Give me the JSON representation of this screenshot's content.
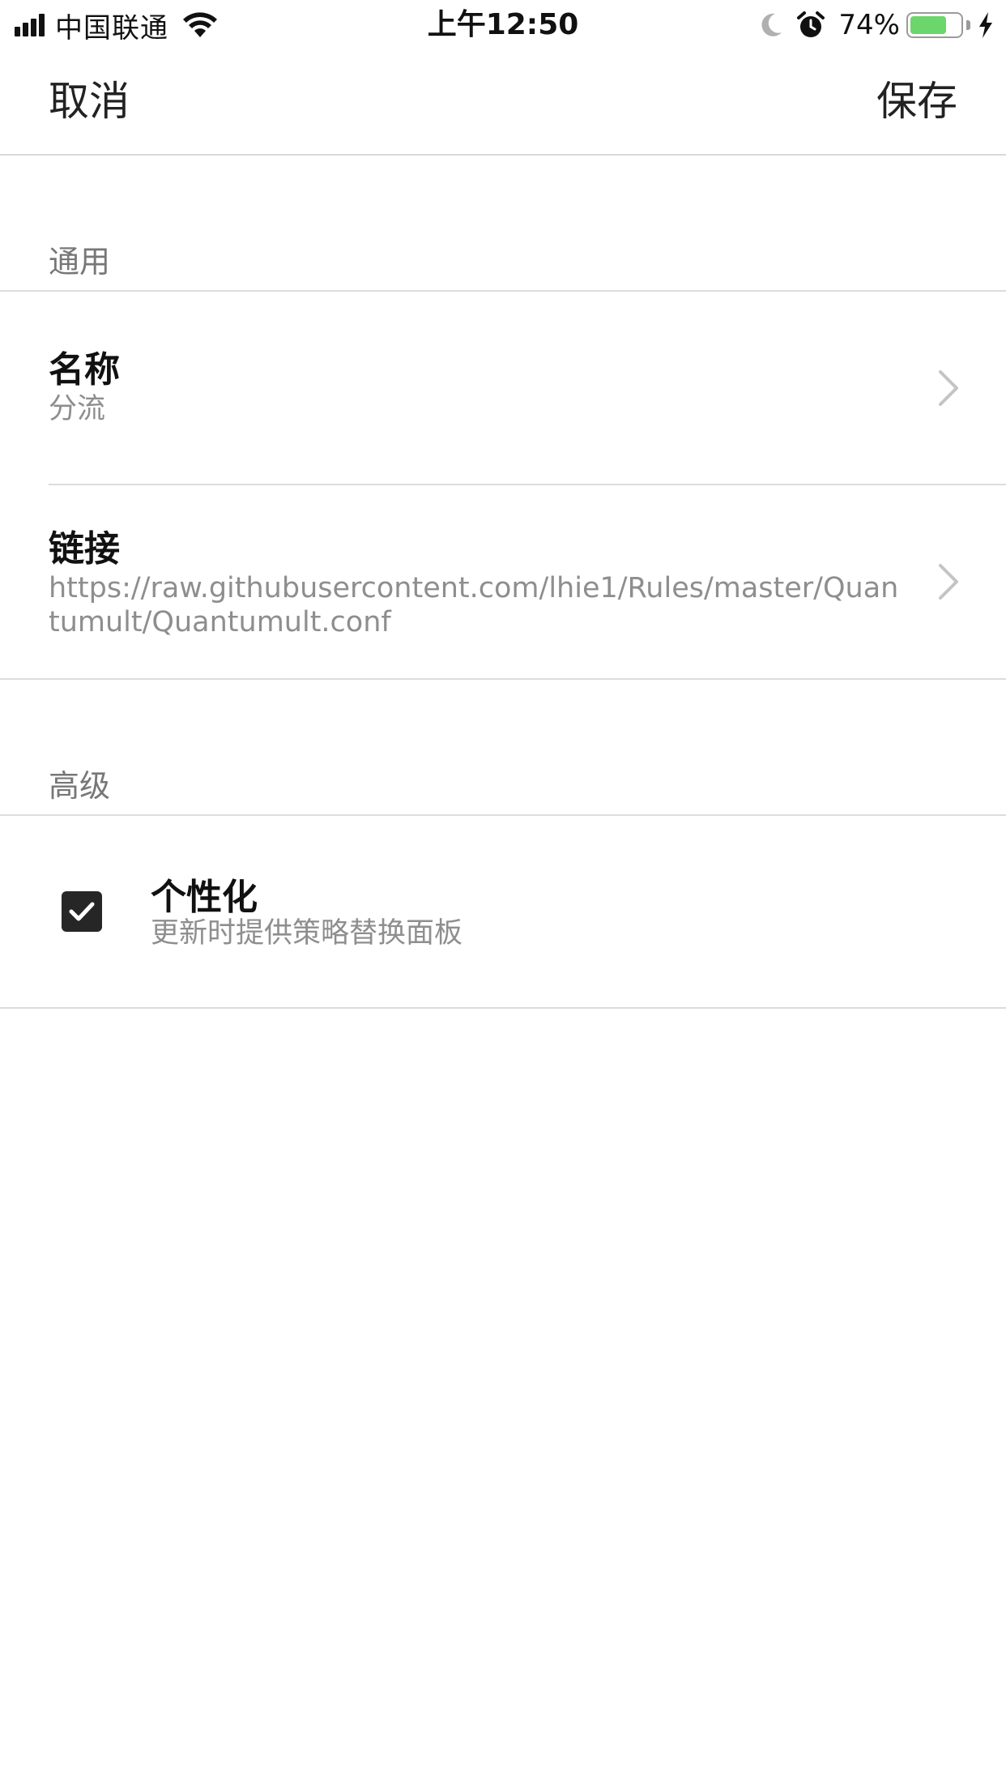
{
  "status_bar": {
    "carrier": "中国联通",
    "time": "上午12:50",
    "battery_percent": "74%",
    "battery_level": 0.74,
    "battery_color": "#6bd66b"
  },
  "nav": {
    "cancel_label": "取消",
    "save_label": "保存"
  },
  "general": {
    "section_title": "通用",
    "name_title": "名称",
    "name_value": "分流",
    "link_title": "链接",
    "link_value": "https://raw.githubusercontent.com/lhie1/Rules/master/Quantumult/Quantumult.conf"
  },
  "advanced": {
    "section_title": "高级",
    "personalize_title": "个性化",
    "personalize_subtitle": "更新时提供策略替换面板",
    "personalize_checked": true
  },
  "icons": [
    "signal-icon",
    "wifi-icon",
    "moon-icon",
    "alarm-icon",
    "battery-icon",
    "charging-icon",
    "chevron-right-icon",
    "checkmark-icon"
  ]
}
